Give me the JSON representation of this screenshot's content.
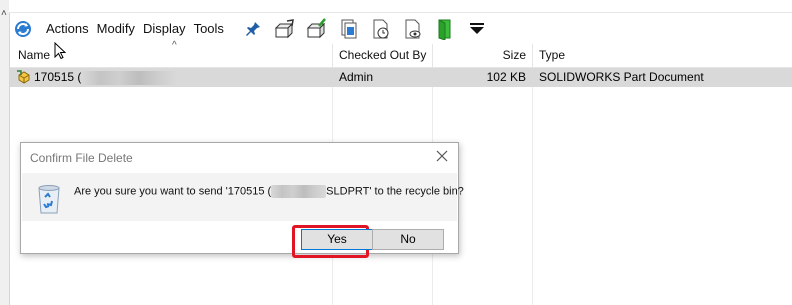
{
  "toolbar": {
    "menus": [
      "Actions",
      "Modify",
      "Display",
      "Tools"
    ]
  },
  "columns": {
    "name": "Name",
    "checked_out_by": "Checked Out By",
    "size": "Size",
    "type": "Type"
  },
  "file": {
    "name_prefix": "170515 (",
    "checked_out_by": "Admin",
    "size": "102 KB",
    "type": "SOLIDWORKS Part Document"
  },
  "dialog": {
    "title": "Confirm File Delete",
    "message_start": "Are you sure you want to send '170515 (",
    "message_end": "SLDPRT' to the recycle bin?",
    "yes_label": "Yes",
    "no_label": "No"
  },
  "colors": {
    "highlight": "#e01525",
    "selected_row": "#d9d9d9",
    "focus_border": "#0078d7"
  }
}
